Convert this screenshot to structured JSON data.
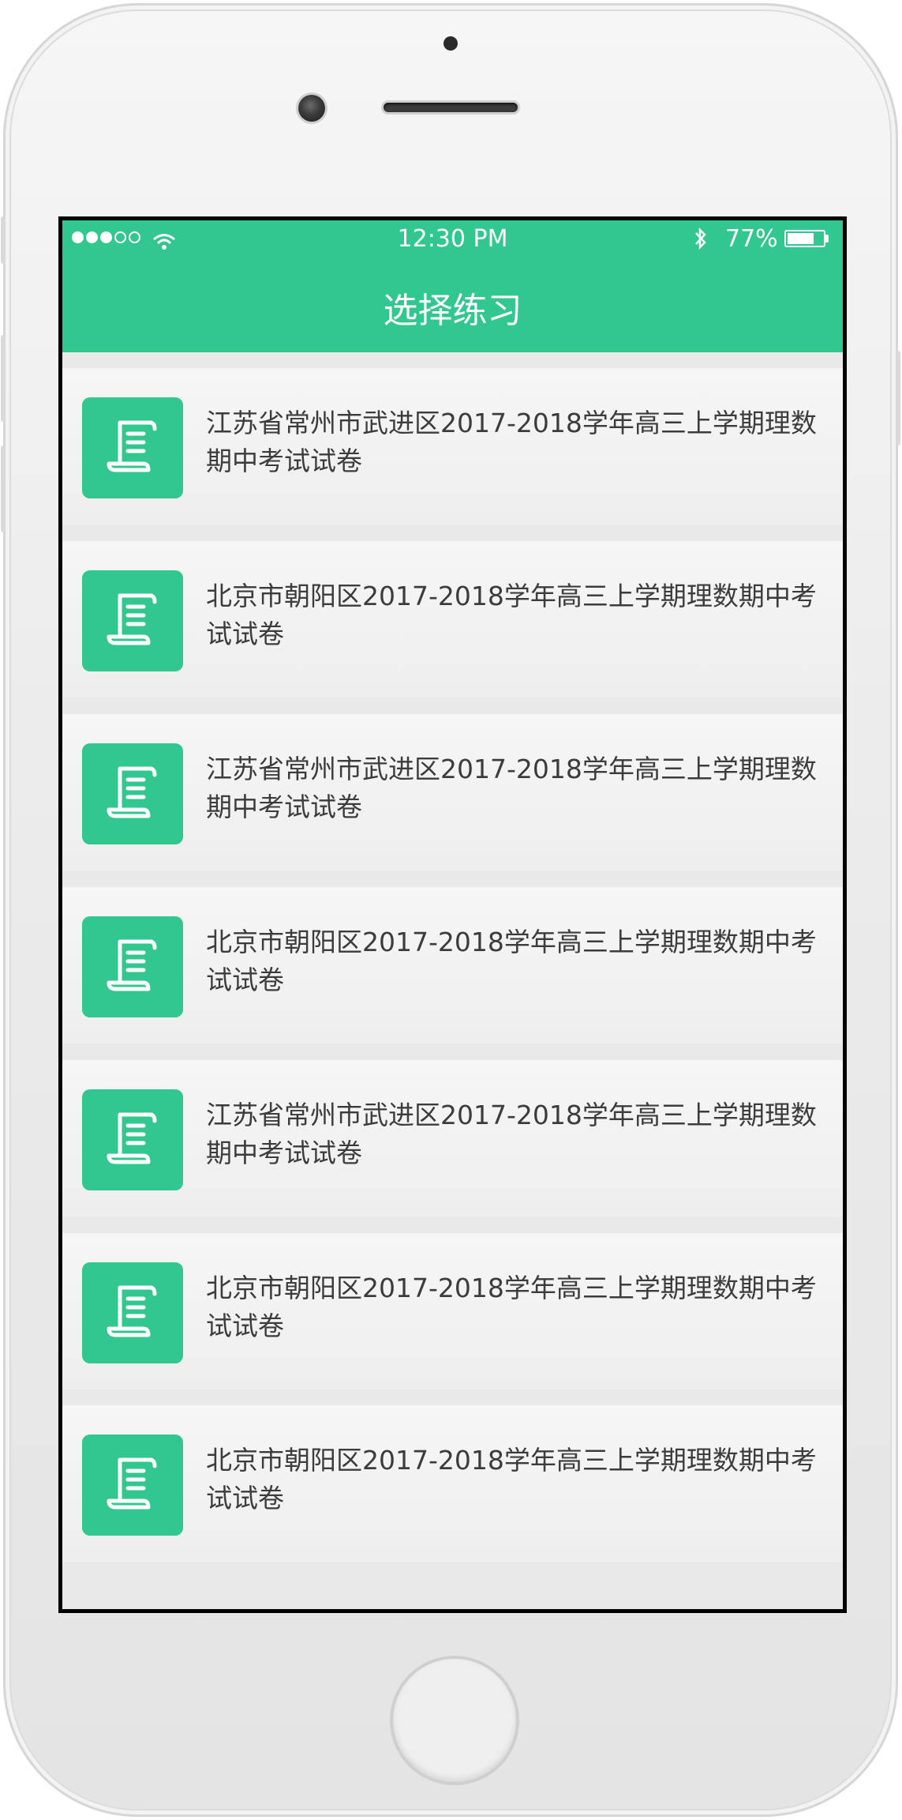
{
  "status_bar": {
    "time": "12:30 PM",
    "battery": "77%",
    "battery_level": 0.77,
    "icons": [
      "signal-dots-icon",
      "wifi-icon",
      "bluetooth-icon",
      "battery-icon"
    ]
  },
  "nav": {
    "title": "选择练习"
  },
  "colors": {
    "accent": "#31c78e",
    "background": "#e9e9e9",
    "text": "#3c3c3c"
  },
  "list": {
    "items": [
      {
        "title": "江苏省常州市武进区2017-2018学年高三上学期理数期中考试试卷",
        "icon": "document-scroll-icon"
      },
      {
        "title": "北京市朝阳区2017-2018学年高三上学期理数期中考试试卷",
        "icon": "document-scroll-icon"
      },
      {
        "title": "江苏省常州市武进区2017-2018学年高三上学期理数期中考试试卷",
        "icon": "document-scroll-icon"
      },
      {
        "title": "北京市朝阳区2017-2018学年高三上学期理数期中考试试卷",
        "icon": "document-scroll-icon"
      },
      {
        "title": "江苏省常州市武进区2017-2018学年高三上学期理数期中考试试卷",
        "icon": "document-scroll-icon"
      },
      {
        "title": "北京市朝阳区2017-2018学年高三上学期理数期中考试试卷",
        "icon": "document-scroll-icon"
      },
      {
        "title": "北京市朝阳区2017-2018学年高三上学期理数期中考试试卷",
        "icon": "document-scroll-icon"
      }
    ]
  }
}
